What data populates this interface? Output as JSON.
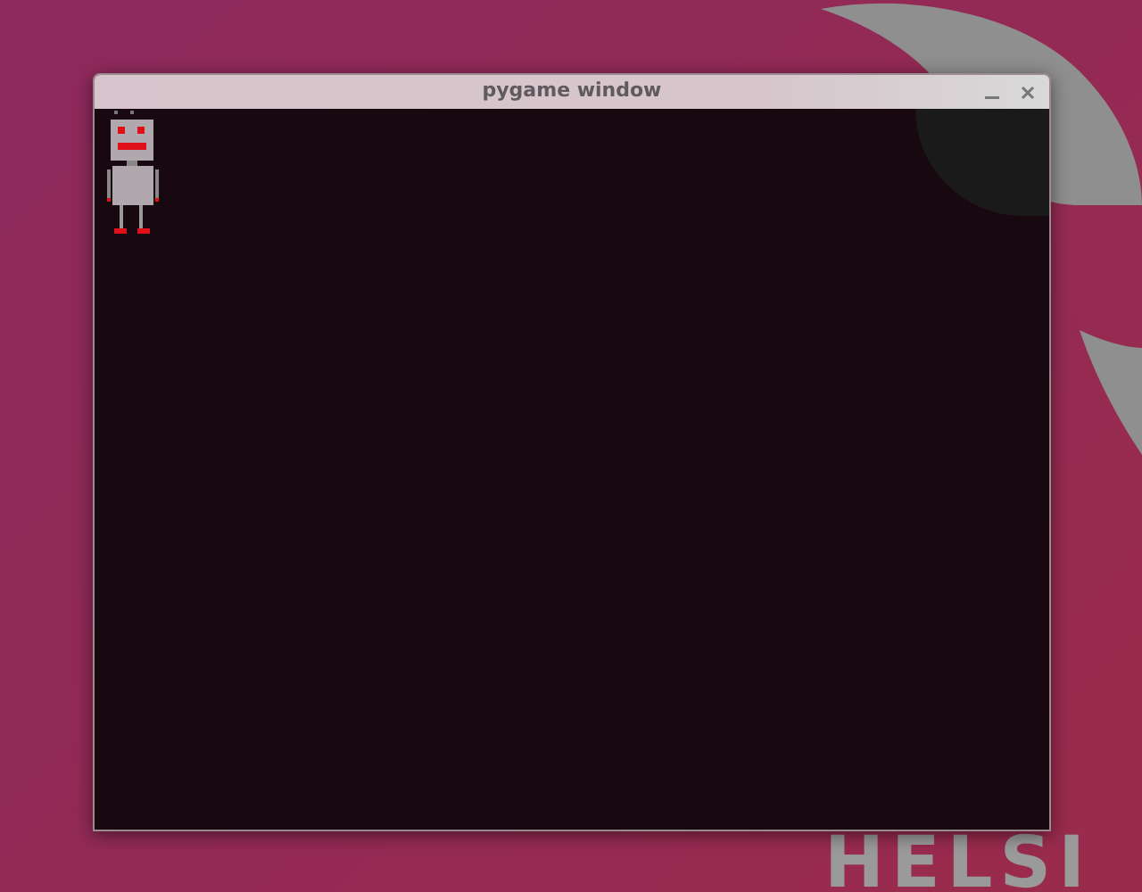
{
  "desktop": {
    "wallpaper_text": "HELSI"
  },
  "window": {
    "title": "pygame window"
  }
}
